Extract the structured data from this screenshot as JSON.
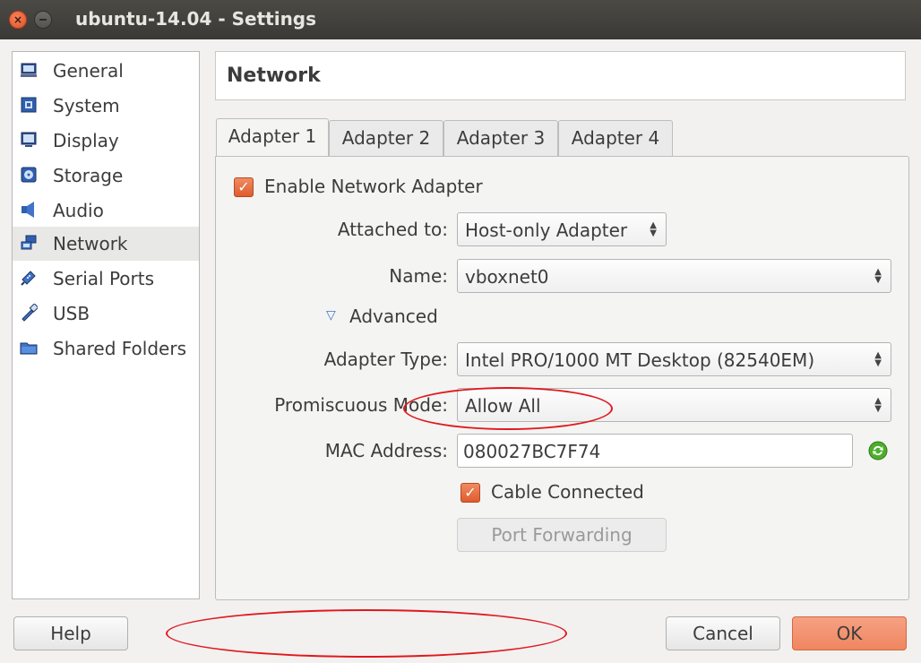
{
  "window": {
    "title": "ubuntu-14.04 - Settings",
    "close_glyph": "×"
  },
  "sidebar": {
    "items": [
      {
        "label": "General",
        "icon": "general-icon"
      },
      {
        "label": "System",
        "icon": "system-icon"
      },
      {
        "label": "Display",
        "icon": "display-icon"
      },
      {
        "label": "Storage",
        "icon": "storage-icon"
      },
      {
        "label": "Audio",
        "icon": "audio-icon"
      },
      {
        "label": "Network",
        "icon": "network-icon",
        "selected": true
      },
      {
        "label": "Serial Ports",
        "icon": "serial-ports-icon"
      },
      {
        "label": "USB",
        "icon": "usb-icon"
      },
      {
        "label": "Shared Folders",
        "icon": "shared-folders-icon"
      }
    ]
  },
  "header": {
    "title": "Network"
  },
  "tabs": [
    {
      "label": "Adapter 1",
      "active": true
    },
    {
      "label": "Adapter 2"
    },
    {
      "label": "Adapter 3"
    },
    {
      "label": "Adapter 4"
    }
  ],
  "adapter": {
    "enable_label": "Enable Network Adapter",
    "enabled": true,
    "attached_label": "Attached to:",
    "attached_value": "Host-only Adapter",
    "name_label": "Name:",
    "name_value": "vboxnet0",
    "advanced_label": "Advanced",
    "adapter_type_label": "Adapter Type:",
    "adapter_type_value": "Intel PRO/1000 MT Desktop (82540EM)",
    "promiscuous_label": "Promiscuous Mode:",
    "promiscuous_value": "Allow All",
    "mac_label": "MAC Address:",
    "mac_value": "080027BC7F74",
    "cable_label": "Cable Connected",
    "cable_connected": true,
    "port_forwarding_label": "Port Forwarding"
  },
  "footer": {
    "help_label": "Help",
    "cancel_label": "Cancel",
    "ok_label": "OK"
  },
  "colors": {
    "accent": "#ef8660",
    "checkbox": "#df5c2e",
    "annotation": "#e0191e",
    "titlebar": "#3c3b37"
  }
}
